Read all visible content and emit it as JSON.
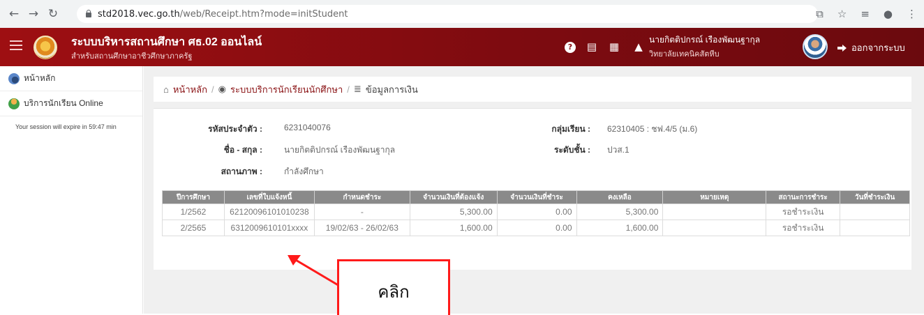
{
  "browser": {
    "url_host": "std2018.vec.go.th",
    "url_path": "/web/Receipt.htm?mode=initStudent"
  },
  "header": {
    "title": "ระบบบริหารสถานศึกษา ศธ.02 ออนไลน์",
    "subtitle": "สำหรับสถานศึกษาอาชีวศึกษาภาครัฐ",
    "user_name": "นายกิตติปกรณ์ เรืองพัฒนฐากุล",
    "user_school": "วิทยาลัยเทคนิคสัตหีบ",
    "logout_label": "ออกจากระบบ"
  },
  "sidebar": {
    "items": [
      {
        "label": "หน้าหลัก",
        "icon": "dashboard-icon"
      },
      {
        "label": "บริการนักเรียน Online",
        "icon": "student-icon"
      }
    ],
    "session_text": "Your session will expire in 59:47 min"
  },
  "breadcrumb": {
    "home": "หน้าหลัก",
    "service": "ระบบบริการนักเรียนนักศึกษา",
    "current": "ข้อมูลการเงิน"
  },
  "student": {
    "id_label": "รหัสประจำตัว :",
    "id_value": "6231040076",
    "name_label": "ชื่อ - สกุล :",
    "name_value": "นายกิตติปกรณ์ เรืองพัฒนฐากุล",
    "status_label": "สถานภาพ :",
    "status_value": "กำลังศึกษา",
    "group_label": "กลุ่มเรียน :",
    "group_value": "62310405 : ชฟ.4/5 (ม.6)",
    "level_label": "ระดับชั้น :",
    "level_value": "ปวส.1"
  },
  "table": {
    "headers": [
      "ปีการศึกษา",
      "เลขที่ใบแจ้งหนี้",
      "กำหนดชำระ",
      "จำนวนเงินที่ต้องแจ้ง",
      "จำนวนเงินที่ชำระ",
      "คงเหลือ",
      "หมายเหตุ",
      "สถานะการชำระ",
      "วันที่ชำระเงิน"
    ],
    "rows": [
      [
        "1/2562",
        "62120096101010238",
        "-",
        "5,300.00",
        "0.00",
        "5,300.00",
        "",
        "รอชำระเงิน",
        ""
      ],
      [
        "2/2565",
        "6312009610101xxxx",
        "19/02/63 - 26/02/63",
        "1,600.00",
        "0.00",
        "1,600.00",
        "",
        "รอชำระเงิน",
        ""
      ]
    ]
  },
  "annotation": {
    "label": "คลิก"
  },
  "colors": {
    "header_red": "#8a0c10",
    "link_blue": "#2a74b5",
    "annotation_red": "#ff1a1a"
  }
}
